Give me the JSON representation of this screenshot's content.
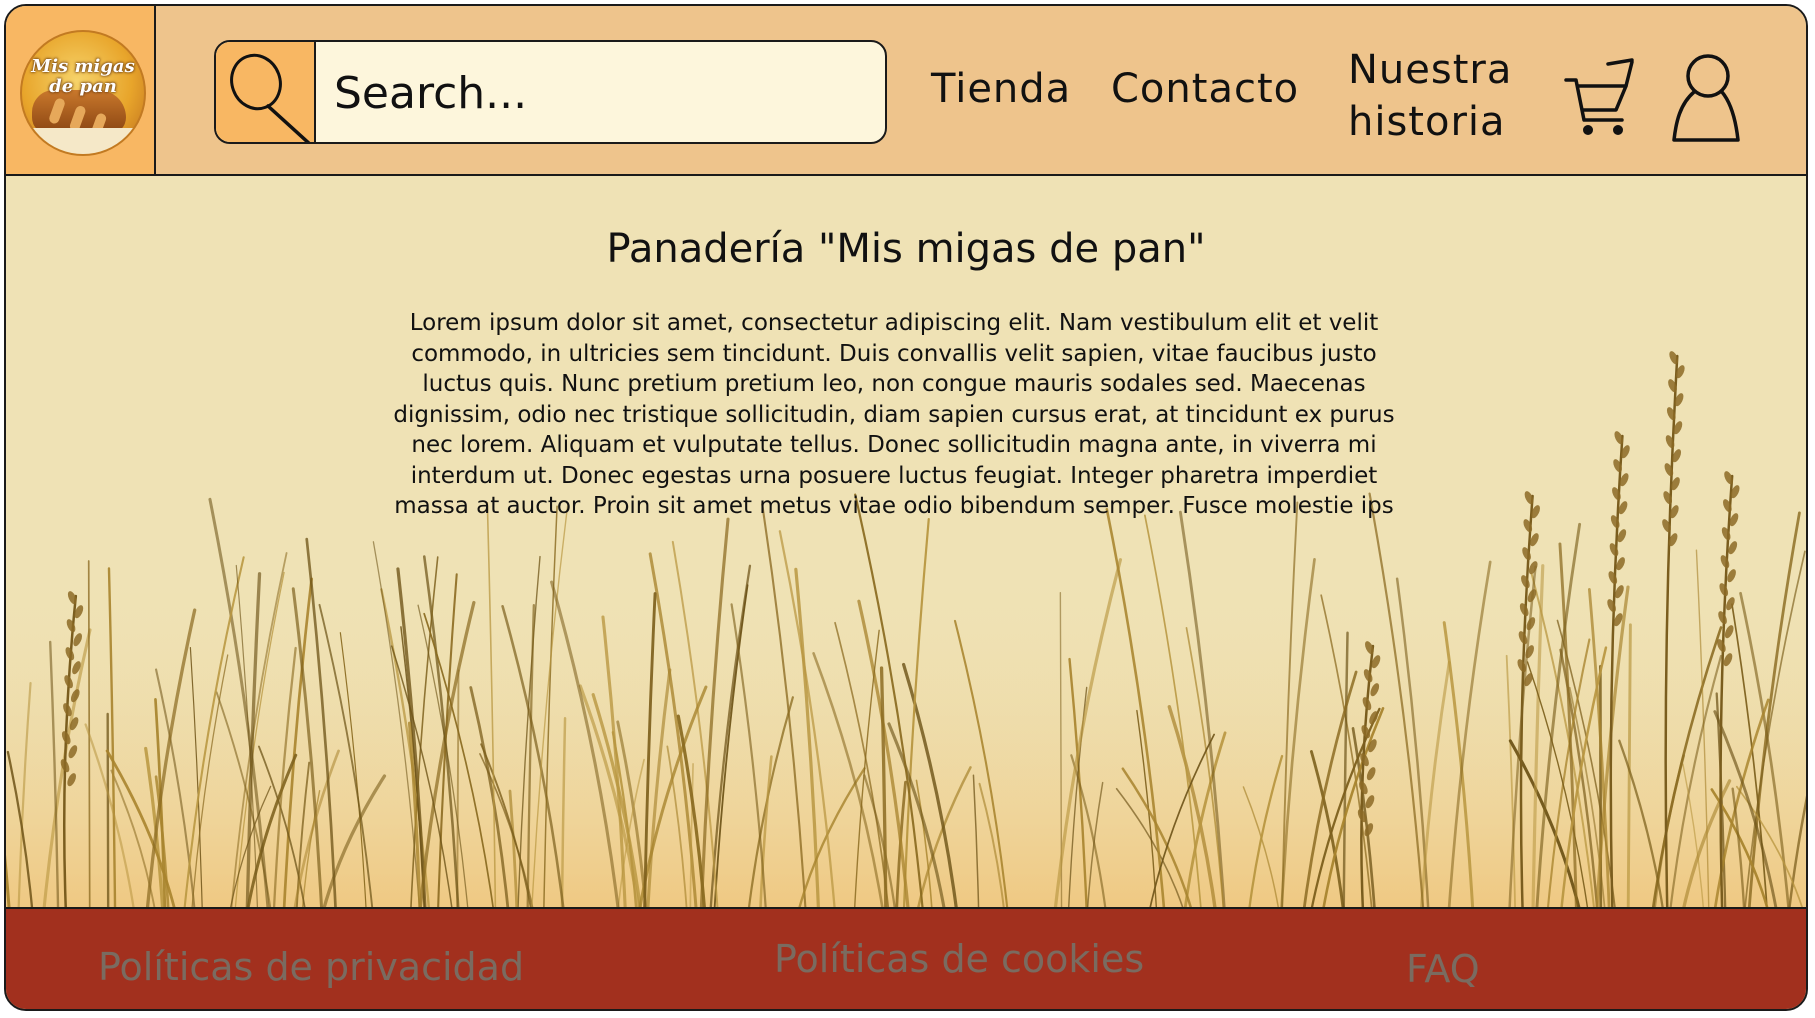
{
  "header": {
    "logo": {
      "line1": "Mis migas",
      "line2": "de pan",
      "icon": "bakery-logo"
    },
    "search": {
      "placeholder": "Search...",
      "icon": "search-icon"
    },
    "nav": {
      "tienda": "Tienda",
      "contacto": "Contacto",
      "historia_line1": "Nuestra",
      "historia_line2": "historia"
    },
    "cart_icon": "cart-icon",
    "user_icon": "user-icon"
  },
  "main": {
    "title": "Panadería \"Mis migas de pan\"",
    "text": "Lorem ipsum dolor sit amet, consectetur adipiscing elit. Nam vestibulum elit et velit commodo, in ultricies sem tincidunt. Duis convallis velit sapien, vitae faucibus justo luctus quis. Nunc pretium pretium leo, non congue mauris sodales sed. Maecenas dignissim, odio nec tristique sollicitudin, diam sapien cursus erat, at tincidunt ex purus nec lorem. Aliquam et vulputate tellus. Donec sollicitudin magna ante, in viverra mi interdum ut. Donec egestas urna posuere luctus feugiat. Integer pharetra imperdiet massa at auctor. Proin sit amet metus vitae odio bibendum semper. Fusce molestie ips"
  },
  "footer": {
    "privacy": "Políticas de privacidad",
    "cookies": "Políticas de cookies",
    "faq": "FAQ"
  },
  "colors": {
    "header_bg": "#eec48c",
    "accent": "#f8b763",
    "main_bg": "#efe2b5",
    "footer_bg": "#a2301e",
    "footer_text": "#7a6b60"
  }
}
